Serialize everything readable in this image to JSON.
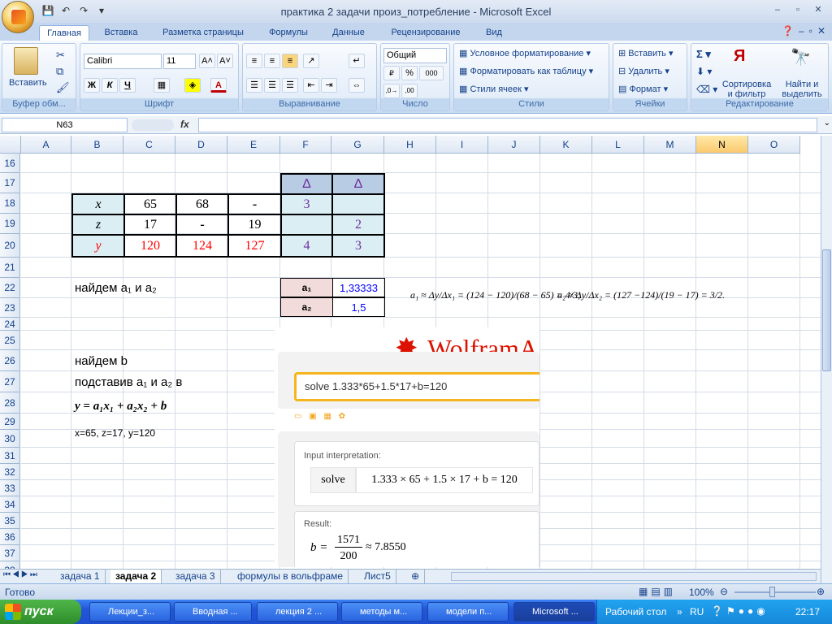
{
  "window": {
    "title": "практика 2 задачи произ_потребление - Microsoft Excel",
    "tabs": [
      "Главная",
      "Вставка",
      "Разметка страницы",
      "Формулы",
      "Данные",
      "Рецензирование",
      "Вид"
    ]
  },
  "ribbon": {
    "clipboard": {
      "label": "Буфер обм...",
      "paste": "Вставить"
    },
    "font": {
      "label": "Шрифт",
      "name": "Calibri",
      "size": "11",
      "bold": "Ж",
      "italic": "К",
      "underline": "Ч"
    },
    "alignment": {
      "label": "Выравнивание"
    },
    "number": {
      "label": "Число",
      "format": "Общий"
    },
    "styles": {
      "label": "Стили",
      "cond": "Условное форматирование",
      "table": "Форматировать как таблицу",
      "cell": "Стили ячеек"
    },
    "cells": {
      "label": "Ячейки",
      "insert": "Вставить",
      "delete": "Удалить",
      "format": "Формат"
    },
    "editing": {
      "label": "Редактирование",
      "sort": "Сортировка и фильтр",
      "find": "Найти и выделить"
    }
  },
  "formula_bar": {
    "name_box": "N63",
    "fx": "fx",
    "formula": ""
  },
  "columns": [
    "A",
    "B",
    "C",
    "D",
    "E",
    "F",
    "G",
    "H",
    "I",
    "J",
    "K",
    "L",
    "M",
    "N",
    "O"
  ],
  "selected_column": "N",
  "rows": [
    "16",
    "17",
    "18",
    "19",
    "20",
    "21",
    "22",
    "23",
    "24",
    "25",
    "26",
    "27",
    "28",
    "29",
    "30",
    "31",
    "32",
    "33",
    "34",
    "35",
    "36",
    "37",
    "38"
  ],
  "table": {
    "delta1": "Δ",
    "delta2": "Δ",
    "x": "x",
    "x_c": "65",
    "x_d": "68",
    "x_e": "-",
    "x_f": "3",
    "z": "z",
    "z_c": "17",
    "z_d": "-",
    "z_e": "19",
    "z_g": "2",
    "y": "y",
    "y_c": "120",
    "y_d": "124",
    "y_e": "127",
    "y_f": "4",
    "y_g": "3"
  },
  "notes": {
    "find_a": "найдем a₁ и a₂",
    "a1_label": "a₁",
    "a1_value": "1,33333",
    "a2_label": "a₂",
    "a2_value": "1,5",
    "find_b": "найдем b",
    "subst": "подставив a₁ и a₂ в",
    "eq": "y = a₁x₁ + a₂x₂ + b",
    "vals": "x=65, z=17, y=120"
  },
  "formula_image": {
    "a1": "a₁ ≈ Δy/Δx₁ = (124 − 120)/(68 − 65) = 4/3;",
    "a2": "a₂ ≈ Δy/Δx₂ = (127 −124)/(19 − 17) = 3/2."
  },
  "wolfram": {
    "brand": "WolframA",
    "query": "solve 1.333*65+1.5*17+b=120",
    "input_label": "Input interpretation:",
    "solve": "solve",
    "input_expr": "1.333 × 65 + 1.5 × 17 + b = 120",
    "result_label": "Result:",
    "result_b": "b =",
    "result_num": "1571",
    "result_den": "200",
    "result_approx": "≈ 7.8550"
  },
  "sheets": [
    "задача 1",
    "задача 2",
    "задача 3",
    "формулы в вольфраме",
    "Лист5"
  ],
  "active_sheet": "задача 2",
  "status": {
    "ready": "Готово",
    "zoom": "100%"
  },
  "taskbar": {
    "start": "пуск",
    "items": [
      "Лекции_з...",
      "Вводная ...",
      "лекция 2 ...",
      "методы м...",
      "модели п...",
      "Microsoft ..."
    ],
    "desktop": "Рабочий стол",
    "lang": "RU",
    "time": "22:17"
  }
}
